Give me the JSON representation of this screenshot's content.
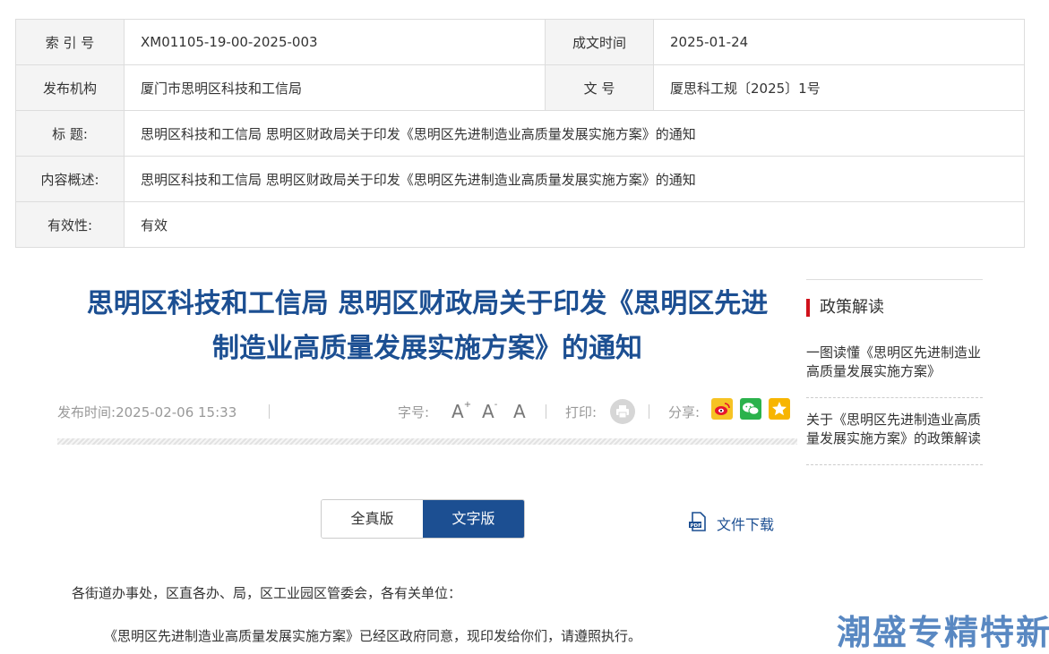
{
  "meta": {
    "rows": [
      {
        "l1": "索 引 号",
        "v1": "XM01105-19-00-2025-003",
        "l2": "成文时间",
        "v2": "2025-01-24"
      },
      {
        "l1": "发布机构",
        "v1": "厦门市思明区科技和工信局",
        "l2": "文 号",
        "v2": "厦思科工规〔2025〕1号"
      }
    ],
    "title_label": "标 题:",
    "title_value": "思明区科技和工信局 思明区财政局关于印发《思明区先进制造业高质量发展实施方案》的通知",
    "summary_label": "内容概述:",
    "summary_value": "思明区科技和工信局 思明区财政局关于印发《思明区先进制造业高质量发展实施方案》的通知",
    "validity_label": "有效性:",
    "validity_value": "有效"
  },
  "article": {
    "title_line1": "思明区科技和工信局 思明区财政局关于印发《思明区先进",
    "title_line2": "制造业高质量发展实施方案》的通知",
    "publish_label": "发布时间:",
    "publish_time": "2025-02-06 15:33",
    "fontsize_label": "字号:",
    "fontsize_large": "A",
    "fontsize_large_sup": "+",
    "fontsize_small": "A",
    "fontsize_small_sup": "-",
    "fontsize_default": "A",
    "print_label": "打印:",
    "share_label": "分享:",
    "share_icons": [
      "weibo-icon",
      "wechat-icon",
      "qzone-icon"
    ],
    "tab_full": "全真版",
    "tab_text": "文字版",
    "download_label": "文件下载",
    "para1": "各街道办事处，区直各办、局，区工业园区管委会，各有关单位：",
    "para2": "《思明区先进制造业高质量发展实施方案》已经区政府同意，现印发给你们，请遵照执行。"
  },
  "sidebar": {
    "heading": "政策解读",
    "items": [
      "一图读懂《思明区先进制造业高质量发展实施方案》",
      "关于《思明区先进制造业高质量发展实施方案》的政策解读"
    ]
  },
  "watermark": "潮盛专精特新",
  "colors": {
    "accent": "#1c4f92",
    "red_bar": "#d0111b"
  }
}
